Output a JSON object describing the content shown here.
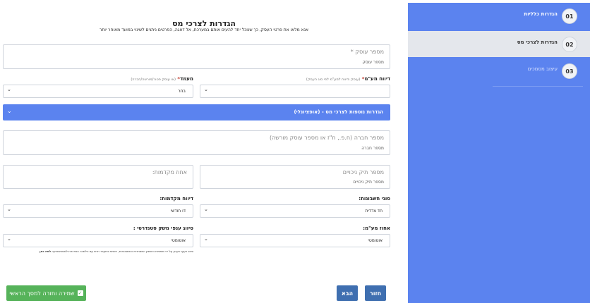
{
  "sidebar": {
    "steps": [
      {
        "num": "01",
        "label": "הגדרות כלליות"
      },
      {
        "num": "02",
        "label": "הגדרות לצרכי מס"
      },
      {
        "num": "03",
        "label": "עיצוב מסמכים"
      }
    ]
  },
  "page": {
    "title": "הגדרות לצרכי מס",
    "subtitle": "אנא מלאו את פרטי העסק, כך שנוכל יחד להעים אותם במערכת, אל דאגה, הפרטים ניתנים לשינוי במועד מאוחר יותר"
  },
  "form": {
    "business_number": {
      "label": "מספר עוסק",
      "required_mark": "*",
      "placeholder": "מספר עוסק"
    },
    "vat_report": {
      "label": "דיווח מע\"מ",
      "required_mark": "*",
      "hint": "(עוסק ודיווח למע\"מ לפי סוג העסק)",
      "value": ""
    },
    "status": {
      "label": "מעמד",
      "required_mark": "*",
      "hint": "(או עוסק פטור/מורשה/חברה)",
      "value": "בחר"
    },
    "accordion": {
      "label": "הגדרות נוספות לצרכי מס - (אופציונלי)"
    },
    "company_number": {
      "label": "מספר חברה (ח.פ., ח\"ז או מספר עוסק מורשה)",
      "placeholder": "מספר חברה"
    },
    "deduction_file": {
      "label": "מספר תיק ניכויים",
      "placeholder": "מספר תיק ניכויים"
    },
    "advance_percent": {
      "label": "אחוז מקדמות:",
      "placeholder": ""
    },
    "account_types": {
      "label": "סוגי חשבונות:",
      "value": "חד צדדית"
    },
    "advance_report": {
      "label": "דיווח מקדמות:",
      "value": "דו חודשי"
    },
    "vat_percent": {
      "label": "אחוז מע\"מ:",
      "value": "אוטומטי"
    },
    "branch_class": {
      "label": "סיווג ענפי משק סטנדרטי :",
      "value": "אוטומטי"
    },
    "note": {
      "text": "סיווג הענף נקבע על ידי שותפות כחשבון המסחרית החשבונאית, רשויות במעבר חדש עם הלשכה המרכזית לסטטיסטיקה",
      "link": "למה כאן"
    }
  },
  "buttons": {
    "back": "חזור",
    "next": "הבא",
    "save_home": "שמירה וחזרה למסך הראשי"
  },
  "colors": {
    "sidebar": "#5b83ef",
    "accent_button": "#3f6fb0",
    "save_button": "#56b35a"
  }
}
